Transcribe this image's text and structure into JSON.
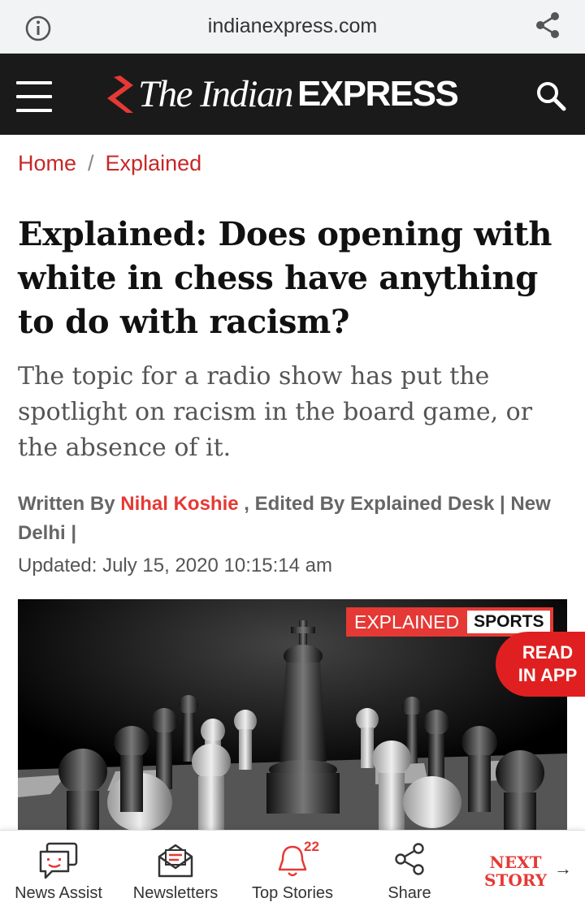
{
  "browser": {
    "url": "indianexpress.com",
    "info_icon": "info-icon",
    "share_icon": "share-icon"
  },
  "header": {
    "logo_serif": "The Indian",
    "logo_sans": "EXPRESS",
    "menu_icon": "hamburger-icon",
    "search_icon": "search-icon",
    "brand_color": "#e53935",
    "bg_color": "#1a1a1a"
  },
  "breadcrumb": {
    "home": "Home",
    "separator": "/",
    "section": "Explained"
  },
  "article": {
    "title": "Explained: Does opening with white in chess have anything to do with racism?",
    "synopsis": "The topic for a radio show has put the spotlight on racism in the board game, or the absence of it.",
    "byline_prefix": "Written By ",
    "author": "Nihal Koshie",
    "byline_suffix": " , Edited By Explained Desk | New Delhi |",
    "updated": "Updated: July 15, 2020 10:15:14 am",
    "image_tag_1": "EXPLAINED",
    "image_tag_2": "SPORTS"
  },
  "read_in_app": {
    "line1": "READ",
    "line2": "IN APP"
  },
  "bottom_nav": {
    "items": [
      {
        "label": "News Assist",
        "icon": "chat-assist-icon"
      },
      {
        "label": "Newsletters",
        "icon": "envelope-icon"
      },
      {
        "label": "Top Stories",
        "icon": "bell-icon",
        "badge": "22"
      },
      {
        "label": "Share",
        "icon": "share-icon"
      }
    ],
    "next_story_line1": "NEXT",
    "next_story_line2": "STORY",
    "next_arrow": "→"
  }
}
